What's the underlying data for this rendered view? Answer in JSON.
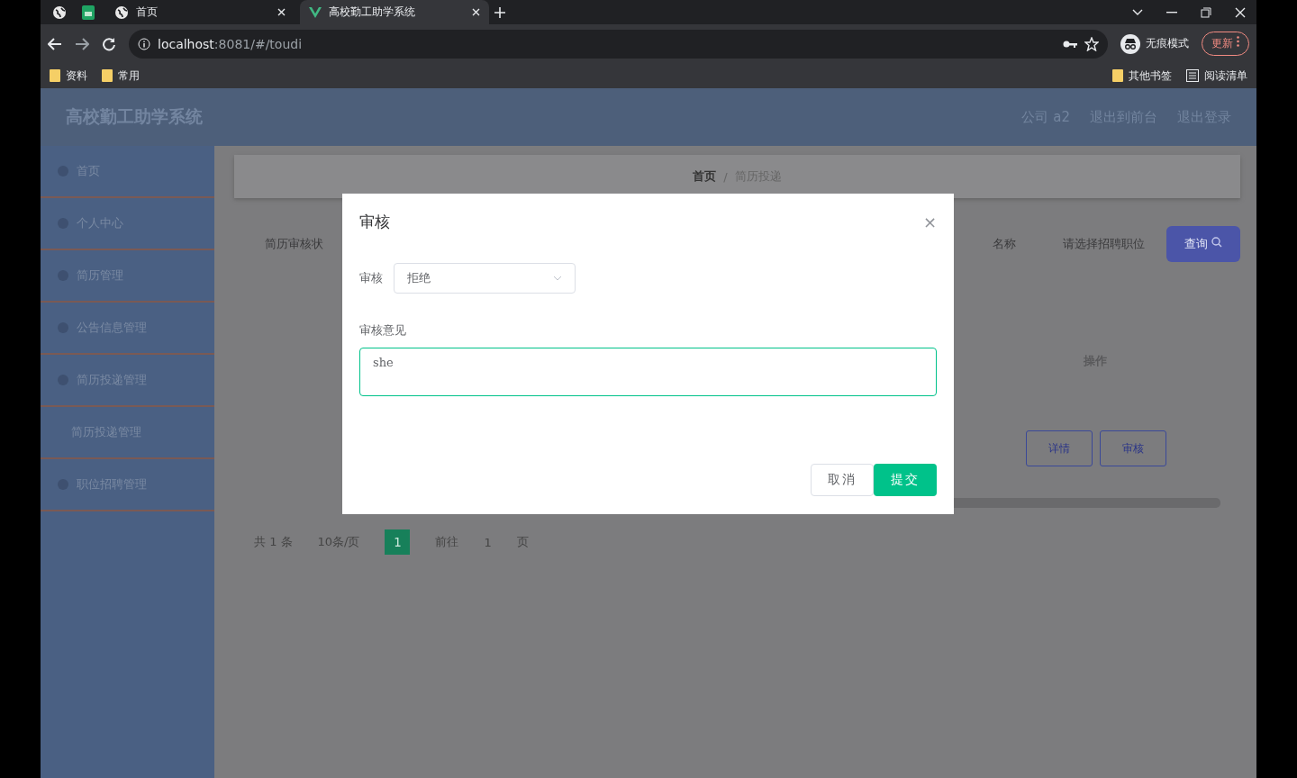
{
  "browser": {
    "tabs": [
      {
        "title": "首页",
        "selected": false
      },
      {
        "title": "高校勤工助学系统",
        "selected": true
      }
    ],
    "url_host": "localhost",
    "url_path": ":8081/#/toudi",
    "profile": "无痕模式",
    "update_button": "更新",
    "bookmarks": [
      "资料",
      "常用"
    ],
    "bookmarks_right": [
      "其他书签"
    ],
    "reading_list": "阅读清单"
  },
  "header": {
    "title": "高校勤工助学系统",
    "links": [
      "公司 a2",
      "退出到前台",
      "退出登录"
    ]
  },
  "sidebar": {
    "items": [
      {
        "label": "首页"
      },
      {
        "label": "个人中心"
      },
      {
        "label": "简历管理"
      },
      {
        "label": "公告信息管理"
      },
      {
        "label": "简历投递管理",
        "children": [
          {
            "label": "简历投递管理"
          }
        ]
      },
      {
        "label": "职位招聘管理"
      }
    ]
  },
  "breadcrumb": [
    "首页",
    "简历投递"
  ],
  "breadcrumb_separator": "/",
  "search": {
    "field_label": "简历审核状",
    "field_label_2": "名称",
    "select_placeholder": "请选择招聘职位",
    "button": "查询"
  },
  "table": {
    "columns": [
      "操作"
    ],
    "row_actions": [
      "详情",
      "审核"
    ]
  },
  "pagination": {
    "total": "共 1 条",
    "page_size": "10条/页",
    "pages": [
      {
        "label": "1",
        "selected": true
      }
    ],
    "goto_label": "前往",
    "goto_value": "1",
    "goto_suffix": "页"
  },
  "dialog": {
    "title": "审核",
    "close": "×",
    "status_label": "审核",
    "status_value": "拒绝",
    "opinion_label": "审核意见",
    "opinion_value": "she",
    "buttons": [
      {
        "label": "取消",
        "kind": "default"
      },
      {
        "label": "提交",
        "kind": "primary"
      }
    ]
  }
}
